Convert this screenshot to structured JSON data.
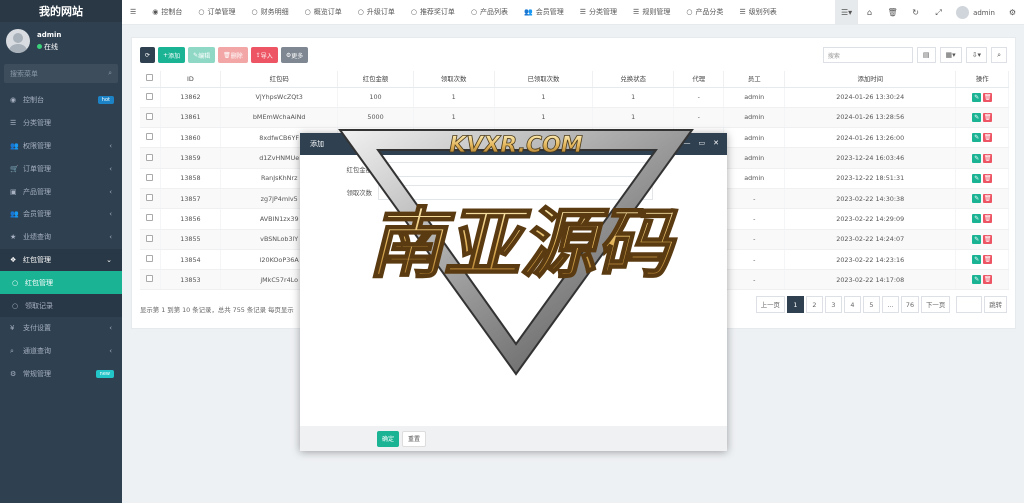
{
  "brand": "我的网站",
  "user": {
    "name": "admin",
    "status": "在线"
  },
  "sidebar": {
    "search_placeholder": "搜索菜单",
    "items": [
      {
        "label": "控制台",
        "icon": "dashboard-icon",
        "badge": "hot",
        "badge_color": "#1c84c6"
      },
      {
        "label": "分类管理",
        "icon": "list-icon"
      },
      {
        "label": "权限管理",
        "icon": "users-icon",
        "arrow": "‹"
      },
      {
        "label": "订单管理",
        "icon": "cart-icon",
        "arrow": "‹"
      },
      {
        "label": "产品管理",
        "icon": "box-icon",
        "arrow": "‹"
      },
      {
        "label": "会员管理",
        "icon": "users-icon",
        "arrow": "‹"
      },
      {
        "label": "业绩查询",
        "icon": "star-icon",
        "arrow": "‹"
      },
      {
        "label": "红包管理",
        "icon": "gift-icon",
        "arrow": "⌄"
      },
      {
        "label": "红包管理",
        "icon": "dot-icon"
      },
      {
        "label": "领取记录",
        "icon": "dot-icon"
      },
      {
        "label": "支付设置",
        "icon": "money-icon",
        "arrow": "‹"
      },
      {
        "label": "通道查询",
        "icon": "search-icon",
        "arrow": "‹"
      },
      {
        "label": "常规管理",
        "icon": "gear-icon",
        "badge": "new",
        "badge_color": "#23c6c8"
      }
    ]
  },
  "topnav": {
    "items": [
      "控制台",
      "订单管理",
      "财务明细",
      "概览订单",
      "升级订单",
      "推荐奖订单",
      "产品列表",
      "会员管理",
      "分类管理",
      "规则管理",
      "产品分类",
      "级别列表"
    ],
    "user": "admin"
  },
  "toolbar": {
    "refresh": "⟳",
    "add": "添加",
    "edit": "编辑",
    "delete": "删除",
    "import": "导入",
    "more": "更多"
  },
  "search_placeholder": "搜索",
  "table": {
    "headers": [
      "ID",
      "红包码",
      "红包金额",
      "领取次数",
      "已领取次数",
      "兑换状态",
      "代理",
      "员工",
      "添加时间",
      "操作"
    ],
    "rows": [
      [
        "13862",
        "VjYhpsWcZQt3",
        "100",
        "1",
        "1",
        "1",
        "-",
        "admin",
        "2024-01-26 13:30:24"
      ],
      [
        "13861",
        "bMEmWchaAiNd",
        "5000",
        "1",
        "1",
        "1",
        "-",
        "admin",
        "2024-01-26 13:28:56"
      ],
      [
        "13860",
        "8xdfwCB6YF",
        "",
        "",
        "",
        "",
        "-",
        "admin",
        "2024-01-26 13:26:00"
      ],
      [
        "13859",
        "d1ZvHNMUe",
        "",
        "",
        "",
        "",
        "-",
        "admin",
        "2023-12-24 16:03:46"
      ],
      [
        "13858",
        "RanJsKhNrz",
        "",
        "",
        "",
        "",
        "-",
        "admin",
        "2023-12-22 18:51:31"
      ],
      [
        "13857",
        "zg7jP4mlv5",
        "",
        "",
        "",
        "",
        "-",
        "-",
        "2023-02-22 14:30:38"
      ],
      [
        "13856",
        "AVBIN1zx39",
        "",
        "",
        "",
        "",
        "-",
        "-",
        "2023-02-22 14:29:09"
      ],
      [
        "13855",
        "vBSNLob3lY",
        "",
        "",
        "",
        "",
        "-",
        "-",
        "2023-02-22 14:24:07"
      ],
      [
        "13854",
        "l20KOoP36A",
        "",
        "",
        "",
        "",
        "-",
        "-",
        "2023-02-22 14:23:16"
      ],
      [
        "13853",
        "jMkC57r4Lo",
        "",
        "",
        "",
        "",
        "-",
        "-",
        "2023-02-22 14:17:08"
      ]
    ]
  },
  "footer": {
    "info": "显示第 1 到第 10 条记录，总共 755 条记录 每页显示",
    "pages": [
      "上一页",
      "1",
      "2",
      "3",
      "4",
      "5",
      "...",
      "76",
      "下一页"
    ],
    "jump": "跳转"
  },
  "modal": {
    "title": "添加",
    "fields": [
      "红包金额",
      "领取次数"
    ],
    "confirm": "确定",
    "reset": "重置"
  },
  "watermark": {
    "top": "KVXR.COM",
    "main": "南亚源码"
  }
}
